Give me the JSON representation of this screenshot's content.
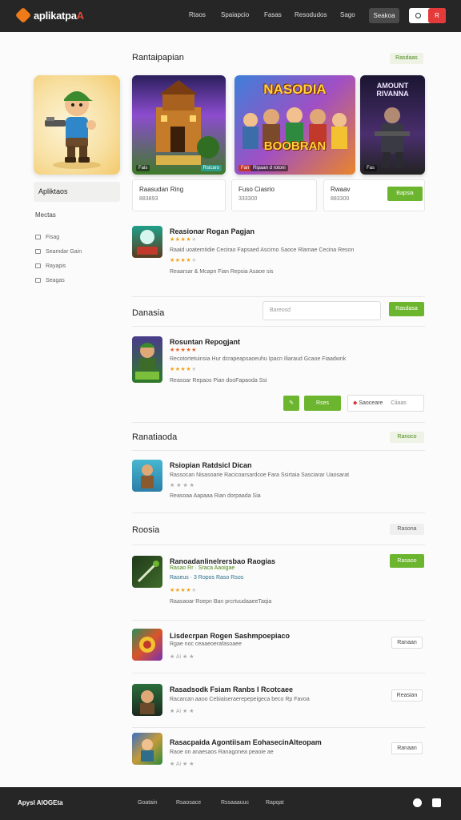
{
  "brand": {
    "name": "aplikatpa",
    "accent": "A"
  },
  "nav": {
    "items": [
      "Rtaos",
      "Spaiapcio",
      "Fasas",
      "Resodudos",
      "Sago"
    ],
    "button": "Seakoa",
    "toggle_label": "R"
  },
  "sidebar": {
    "label": "Apliktaos",
    "section": "Mectas",
    "links": [
      "Fisag",
      "Seamdar Gain",
      "Rayapis",
      "Seagas"
    ]
  },
  "featured": {
    "title": "Rantaipapian",
    "badge": "Rasdaas",
    "banners": [
      {
        "tag": "Fais",
        "caption": "Rsicaro"
      },
      {
        "title": "NASODIA",
        "subtitle": "BOOBRAN",
        "tag": "Fan",
        "caption": "Ripaan d rotoni"
      },
      {
        "title": "AMOUNT RIVANNA",
        "tag": "Fas"
      }
    ],
    "infos": [
      {
        "title": "Raasudan Ring",
        "sub": "883893"
      },
      {
        "title": "Fuso Ciasrio",
        "sub": "333300"
      },
      {
        "title": "Rwaav",
        "sub": "883300"
      }
    ],
    "info_button": "Bapsia"
  },
  "apps": [
    {
      "title": "Reasionar Rogan Pagjan",
      "line1": "Raaid uoatemtidie Cecirao Fapsaed Ascirno Saoce Rlamae Cecina Reson",
      "line2": "Reaarsar & Mcapn Fian Repsia Asaoe sis",
      "rating": 4
    },
    {
      "title": "Rosuntan Repogjant",
      "line1": "Recotortetuinsia Hur dcrapeapsaoeuhu Ipacn Iliaraud Gcaoe Fiaadwnk",
      "line2": "Reasoar Repaos Pian dooFapaoda Ssi",
      "rating": 3
    },
    {
      "title": "Rsiopian Ratdsicl Dican",
      "line1": "Rassocan Nisasoarie Racicoarsardcoe Fara Ssirtaia Sasciarar Uaosarat",
      "line2": "Reasoaa Aapaaa Rian dorpaada Sia",
      "rating": 0
    },
    {
      "title": "Ranoadanlinelrersbao Raogias",
      "line1": "Rasao Rr · Sraca Aaoigae",
      "line2": "Raasaoar Roepn Ban prcrtuudaaeeTaqia",
      "rating": 4
    },
    {
      "title": "Lisdecrpan Rogen Sashmpoepiaco",
      "line1": "Rgae noc ceaaeoerafasoaee",
      "line2": "Ai",
      "rating": 1
    },
    {
      "title": "Rasadsodk Fsiam Ranbs I Rcotcaee",
      "line1": "Racarcan aaoo Cebiaiseraerepepeigeca beco Rp Favoa",
      "line2": "Ai",
      "rating": 1
    },
    {
      "title": "Rasacpaida Agontiisam EohasecinAlteopam",
      "line1": "Raoe on anaesaos Ranagonea peaoie ae",
      "line2": "Ai",
      "rating": 1
    }
  ],
  "section2": {
    "title": "Danasia",
    "search_placeholder": "Bareosd",
    "search_button": "Rasdasa",
    "actions": [
      "Rses",
      "Saoceare",
      "Ciiaas"
    ]
  },
  "section3": {
    "title": "Ranatiaoda",
    "badge": "Ranoco"
  },
  "section4": {
    "title": "Roosia",
    "badge": "Rasona",
    "install_label": "Rasaoo",
    "row_buttons": [
      "Ranaan",
      "Reasian",
      "Ranaan"
    ]
  },
  "footer": {
    "brand": "Apysl AlOGEta",
    "links": [
      "Goatain",
      "Rsaosace",
      "Rssaaauuc",
      "Rapqat"
    ]
  },
  "colors": {
    "accent_green": "#6cb52e",
    "brand_orange": "#ef7a1a",
    "bar_dark": "#262626"
  }
}
